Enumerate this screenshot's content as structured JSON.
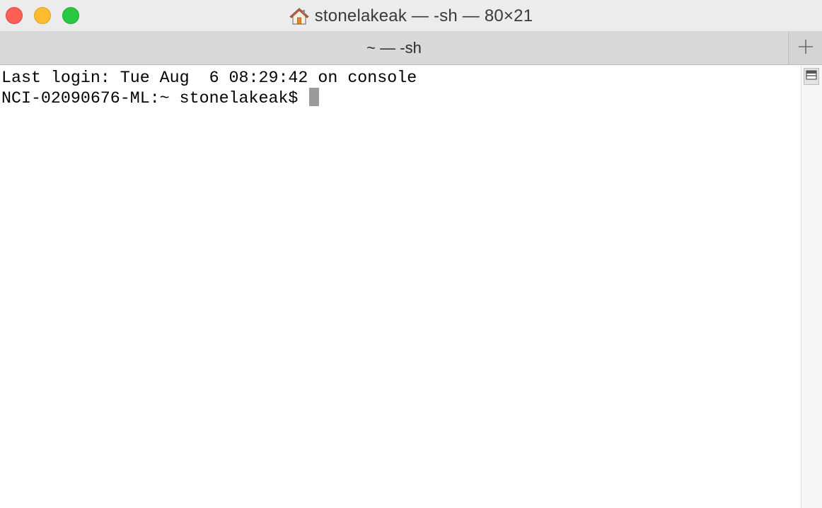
{
  "window": {
    "title": "stonelakeak — -sh — 80×21",
    "title_icon": "home-icon"
  },
  "traffic_lights": {
    "close_color": "#fe5f57",
    "minimize_color": "#febc2e",
    "zoom_color": "#28c840"
  },
  "tabbar": {
    "active_tab_label": "~ — -sh",
    "new_tab_icon": "plus-icon"
  },
  "terminal": {
    "lines": [
      "Last login: Tue Aug  6 08:29:42 on console",
      "NCI-02090676-ML:~ stonelakeak$ "
    ],
    "cursor_color": "#9b9b9b"
  },
  "scrollbar": {
    "split_icon": "split-pane-icon"
  }
}
